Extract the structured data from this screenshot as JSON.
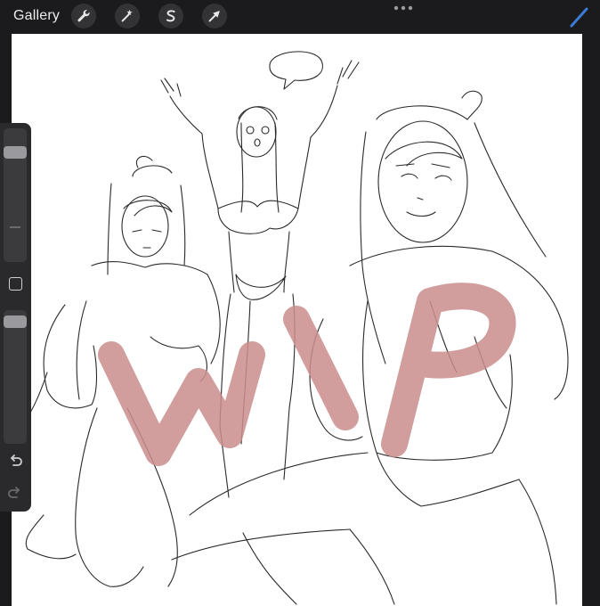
{
  "topbar": {
    "gallery_label": "Gallery",
    "tools": [
      {
        "name": "actions",
        "icon": "wrench-icon"
      },
      {
        "name": "adjustments",
        "icon": "magic-wand-icon"
      },
      {
        "name": "selection",
        "icon": "selection-s-icon"
      },
      {
        "name": "transform",
        "icon": "arrow-cursor-icon"
      }
    ],
    "more_icon": "more-dots-icon",
    "active_tool_icon": "brush-icon",
    "active_tool_color": "#3a7bd5"
  },
  "sidebar": {
    "brush_size_level": 0.93,
    "opacity_level": 0.96,
    "modify_icon": "square-modify-icon",
    "undo_icon": "undo-icon",
    "redo_icon": "redo-icon"
  },
  "canvas": {
    "background": "#ffffff",
    "watermark_text": "WIP",
    "watermark_color": "#c98c8c",
    "speech_bubble_text": "?",
    "content": "line-art-sketch"
  }
}
